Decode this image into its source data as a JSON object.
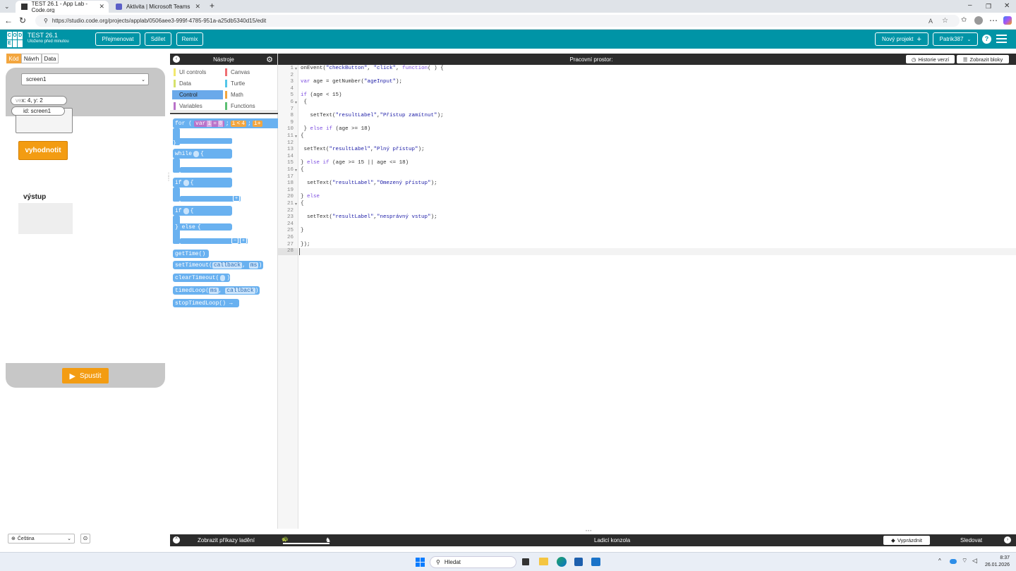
{
  "browser": {
    "tabs": [
      {
        "label": "TEST 26.1 - App Lab - Code.org"
      },
      {
        "label": "Aktivita | Microsoft Teams"
      }
    ],
    "url": "https://studio.code.org/projects/applab/0506aee3-999f-4785-951a-a25db5340d15/edit"
  },
  "header": {
    "logo_letters": [
      "C",
      "O",
      "D",
      "E",
      "",
      ""
    ],
    "project_title": "TEST 26.1",
    "saved_status": "Uloženo před minutou",
    "buttons": {
      "rename": "Přejmenovat",
      "share": "Sdílet",
      "remix": "Remix",
      "new_project": "Nový projekt",
      "user": "Patrik387"
    }
  },
  "left": {
    "mode_tabs": [
      "Kód",
      "Návrh",
      "Data"
    ],
    "screen_select": "screen1",
    "coords": "x: 4, y: 2",
    "coords_prefix": "ve",
    "element_id": "id: screen1",
    "evaluate_button": "vyhodnotit",
    "output_label": "výstup",
    "run_button": "Spustit",
    "language": "Čeština"
  },
  "tools": {
    "title": "Nástroje",
    "categories": [
      {
        "label": "UI controls",
        "color": "#f2e86d"
      },
      {
        "label": "Canvas",
        "color": "#ee6e73"
      },
      {
        "label": "Data",
        "color": "#d6e26b"
      },
      {
        "label": "Turtle",
        "color": "#54c6e8"
      },
      {
        "label": "Control",
        "color": "#6aa9ea"
      },
      {
        "label": "Math",
        "color": "#f3a63f"
      },
      {
        "label": "Variables",
        "color": "#b972c9"
      },
      {
        "label": "Functions",
        "color": "#5cbf73"
      }
    ],
    "selected": "Control",
    "blocks": {
      "for_kw": "for (",
      "for_var": "var",
      "for_i": "i",
      "for_eq": "=",
      "for_zero": "0",
      "for_cond_i": "i",
      "for_lt": "<",
      "for_four": "4",
      "for_semi": ";",
      "for_inc": "i+",
      "while": "while",
      "if1": "if",
      "if2": "if",
      "else": "} else",
      "getTime": "getTime()",
      "setTimeout": "setTimeout(",
      "setTimeout_cb": "callback",
      "setTimeout_ms": "ms",
      "clearTimeout": "clearTimeout(",
      "timedLoop": "timedLoop(",
      "timedLoop_ms": "ms",
      "timedLoop_cb": "callback",
      "stopTimedLoop": "stopTimedLoop() →"
    }
  },
  "workspace": {
    "title": "Pracovní prostor:",
    "history_button": "Historie verzí",
    "show_blocks_button": "Zobrazit bloky",
    "lines": [
      "onEvent(\"checkButton\", \"click\", function( ) {",
      "",
      "var age = getNumber(\"ageInput\");",
      "",
      "if (age < 15)",
      " {",
      "",
      "   setText(\"resultLabel\",\"Přístup zamítnut\");",
      "",
      " } else if (age >= 18)",
      "{",
      "",
      " setText(\"resultLabel\",\"Plný přístup\");",
      "",
      "} else if (age >= 15 || age <= 18)",
      "{",
      "",
      "  setText(\"resultLabel\",\"Omezený přístup\");",
      "",
      "} else",
      "{",
      "",
      "  setText(\"resultLabel\",\"nesprávný vstup\");",
      "",
      "}",
      "",
      "});",
      ""
    ],
    "fold_lines": [
      1,
      6,
      11,
      16,
      21
    ]
  },
  "bottom": {
    "debug_commands": "Zobrazit příkazy ladění",
    "console": "Ladicí konzola",
    "clear": "Vyprázdnit",
    "watch": "Sledovat"
  },
  "taskbar": {
    "search": "Hledat",
    "time": "8:37",
    "date": "26.01.2026"
  }
}
